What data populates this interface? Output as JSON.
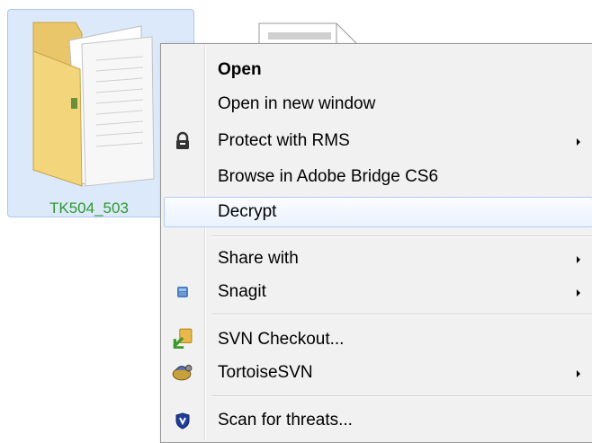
{
  "desktop": {
    "folder_name": "TK504_503"
  },
  "menu": {
    "items": [
      {
        "label": "Open",
        "bold": true
      },
      {
        "label": "Open in new window"
      },
      {
        "label": "Protect with RMS",
        "submenu": true,
        "icon": "rms-lock-icon"
      },
      {
        "label": "Browse in Adobe Bridge CS6"
      },
      {
        "label": "Decrypt",
        "highlighted": true
      },
      {
        "label": "Share with",
        "submenu": true
      },
      {
        "label": "Snagit",
        "submenu": true,
        "icon": "snagit-icon"
      },
      {
        "label": "SVN Checkout...",
        "icon": "svn-checkout-icon"
      },
      {
        "label": "TortoiseSVN",
        "submenu": true,
        "icon": "tortoisesvn-icon"
      },
      {
        "label": "Scan for threats...",
        "icon": "shield-scan-icon"
      }
    ]
  },
  "colors": {
    "folder_label": "#2e9a2e",
    "selection_bg": "#dbe9fb",
    "menu_bg": "#f1f1f1",
    "hover_border": "#aecff7"
  }
}
